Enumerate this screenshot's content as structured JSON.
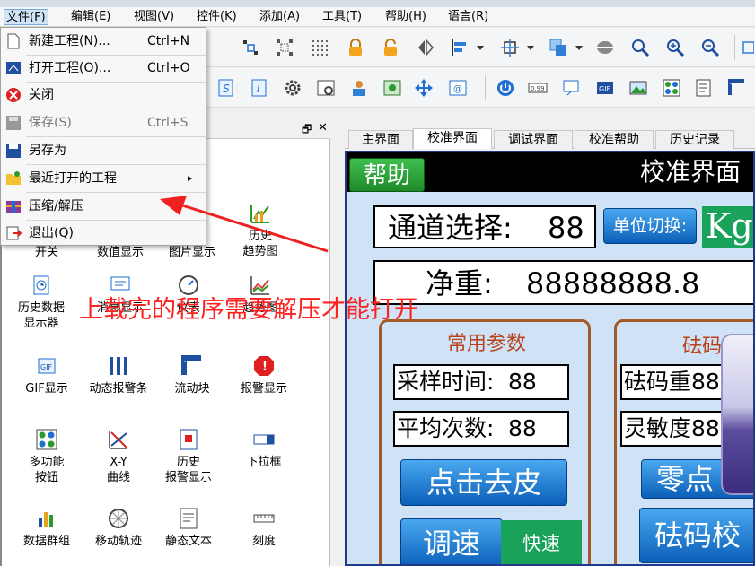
{
  "menubar": {
    "items": [
      {
        "label": "文件(F)",
        "active": true
      },
      {
        "label": "编辑(E)"
      },
      {
        "label": "视图(V)"
      },
      {
        "label": "控件(K)"
      },
      {
        "label": "添加(A)"
      },
      {
        "label": "工具(T)"
      },
      {
        "label": "帮助(H)"
      },
      {
        "label": "语言(R)"
      }
    ]
  },
  "file_menu": {
    "items": [
      {
        "label": "新建工程(N)...",
        "shortcut": "Ctrl+N",
        "icon": "new-file-icon"
      },
      {
        "label": "打开工程(O)...",
        "shortcut": "Ctrl+O",
        "icon": "open-project-icon"
      },
      {
        "label": "关闭",
        "shortcut": "",
        "icon": "close-icon"
      },
      {
        "label": "保存(S)",
        "shortcut": "Ctrl+S",
        "icon": "save-icon"
      },
      {
        "label": "另存为",
        "shortcut": "",
        "icon": "save-as-icon"
      },
      {
        "label": "最近打开的工程",
        "shortcut": "",
        "icon": "recent-folder-icon",
        "submenu": "▸"
      },
      {
        "label": "压缩/解压",
        "shortcut": "",
        "icon": "archive-icon"
      },
      {
        "label": "退出(Q)",
        "shortcut": "",
        "icon": "exit-icon"
      }
    ]
  },
  "toolbox": {
    "tools": [
      {
        "label": "开关",
        "icon": "switch-icon"
      },
      {
        "label": "数值显示",
        "icon": "number-display-icon"
      },
      {
        "label": "图片显示",
        "icon": "picture-display-icon"
      },
      {
        "label": "历史\n趋势图",
        "icon": "history-trend-icon"
      },
      {
        "label": "历史数据\n显示器",
        "icon": "history-data-icon"
      },
      {
        "label": "消息显示",
        "icon": "message-display-icon"
      },
      {
        "label": "仪表",
        "icon": "gauge-icon"
      },
      {
        "label": "趋势图",
        "icon": "trend-chart-icon"
      },
      {
        "label": "GIF显示",
        "icon": "gif-icon"
      },
      {
        "label": "动态报警条",
        "icon": "alarm-bar-icon"
      },
      {
        "label": "流动块",
        "icon": "flow-block-icon"
      },
      {
        "label": "报警显示",
        "icon": "alarm-display-icon"
      },
      {
        "label": "多功能\n按钮",
        "icon": "multi-button-icon"
      },
      {
        "label": "X-Y\n曲线",
        "icon": "xy-curve-icon"
      },
      {
        "label": "历史\n报警显示",
        "icon": "history-alarm-icon"
      },
      {
        "label": "下拉框",
        "icon": "dropdown-box-icon"
      },
      {
        "label": "数据群组",
        "icon": "data-group-icon"
      },
      {
        "label": "移动轨迹",
        "icon": "motion-track-icon"
      },
      {
        "label": "静态文本",
        "icon": "static-text-icon"
      },
      {
        "label": "刻度",
        "icon": "scale-icon"
      }
    ],
    "pin_glyph": "🗗",
    "close_glyph": "✕"
  },
  "tabs": [
    {
      "label": "主界面"
    },
    {
      "label": "校准界面",
      "active": true
    },
    {
      "label": "调试界面"
    },
    {
      "label": "校准帮助"
    },
    {
      "label": "历史记录"
    }
  ],
  "screen": {
    "help_button": "帮助",
    "title": "校准界面",
    "channel_label": "通道选择:",
    "channel_value": "88",
    "unit_switch": "单位切换:",
    "unit_value": "Kg",
    "net_label": "净重:",
    "net_value": "88888888.8",
    "common_group_title": "常用参数",
    "sample_label": "采样时间:",
    "sample_value": "88",
    "avg_label": "平均次数:",
    "avg_value": "88",
    "tare_button": "点击去皮",
    "speed_button": "调速",
    "speed_value": "快速",
    "weight_group_title": "砝码",
    "weight_label": "砝码重88",
    "sensitivity_label": "灵敏度88",
    "zero_button": "零点",
    "calib_button": "砝码校"
  },
  "annotation": {
    "text": "上载完的程序需要解压才能打开",
    "color": "#ff2020"
  }
}
